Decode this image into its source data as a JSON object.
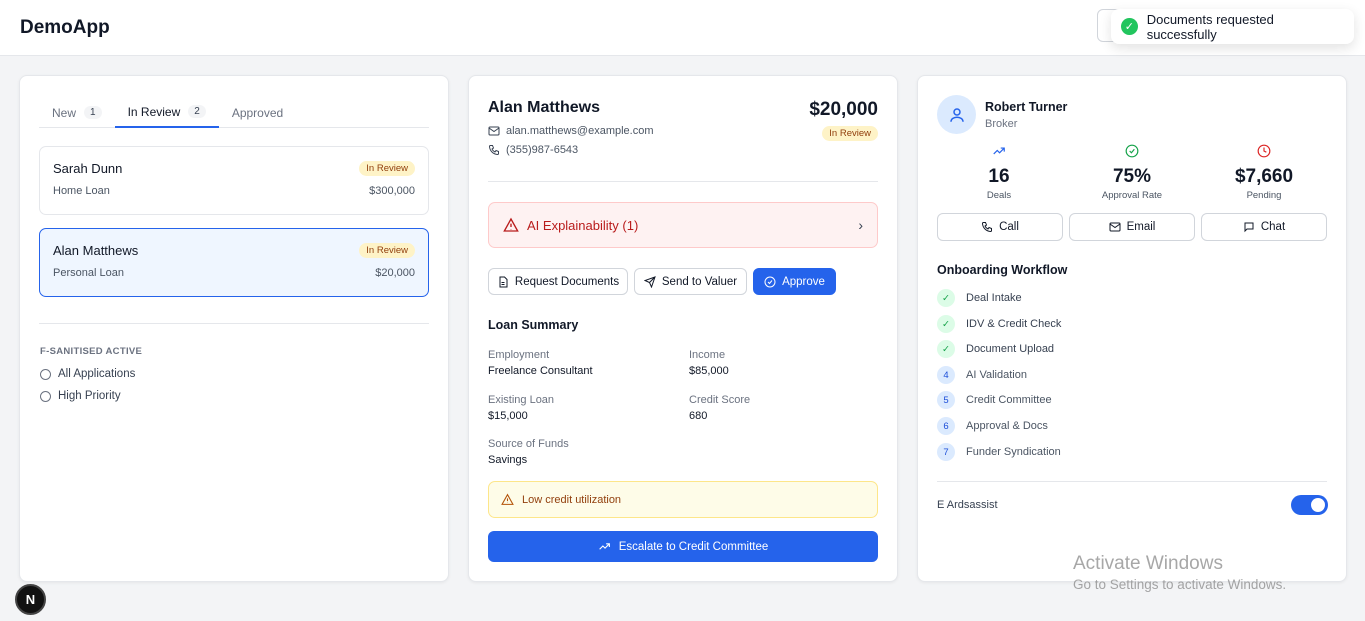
{
  "app": {
    "title": "DemoApp"
  },
  "toast": {
    "message": "Documents requested successfully"
  },
  "left": {
    "tabs": [
      {
        "label": "New",
        "count": "1"
      },
      {
        "label": "In Review",
        "count": "2"
      },
      {
        "label": "Approved",
        "count": ""
      }
    ],
    "cards": [
      {
        "name": "Sarah Dunn",
        "status": "In Review",
        "type": "Home Loan",
        "amount": "$300,000"
      },
      {
        "name": "Alan Matthews",
        "status": "In Review",
        "type": "Personal Loan",
        "amount": "$20,000"
      }
    ],
    "filter_title": "F-SANITISED ACTIVE",
    "filters": [
      "All Applications",
      "High Priority"
    ]
  },
  "detail": {
    "name": "Alan Matthews",
    "amount": "$20,000",
    "status": "In Review",
    "email": "alan.matthews@example.com",
    "phone": "(355)987-6543",
    "ai_label": "AI Explainability (1)",
    "actions": {
      "request_docs": "Request Documents",
      "send_valuer": "Send to Valuer",
      "approve": "Approve"
    },
    "summary_title": "Loan Summary",
    "summary": {
      "employment_label": "Employment",
      "employment": "Freelance Consultant",
      "income_label": "Income",
      "income": "$85,000",
      "existing_label": "Existing Loan",
      "existing": "$15,000",
      "credit_label": "Credit Score",
      "credit": "680",
      "funds_label": "Source of Funds",
      "funds": "Savings"
    },
    "warning": "Low credit utilization",
    "escalate": "Escalate to Credit Committee"
  },
  "broker": {
    "name": "Robert Turner",
    "role": "Broker",
    "stats": [
      {
        "value": "16",
        "label": "Deals",
        "color": "#2563eb"
      },
      {
        "value": "75%",
        "label": "Approval Rate",
        "color": "#16a34a"
      },
      {
        "value": "$7,660",
        "label": "Pending",
        "color": "#dc2626"
      }
    ],
    "contact_buttons": {
      "call": "Call",
      "email": "Email",
      "chat": "Chat"
    },
    "workflow_title": "Onboarding Workflow",
    "workflow": [
      {
        "marker": "✓",
        "label": "Deal Intake",
        "done": true
      },
      {
        "marker": "✓",
        "label": "IDV & Credit Check",
        "done": true
      },
      {
        "marker": "✓",
        "label": "Document Upload",
        "done": true
      },
      {
        "marker": "4",
        "label": "AI Validation",
        "done": false
      },
      {
        "marker": "5",
        "label": "Credit Committee",
        "done": false
      },
      {
        "marker": "6",
        "label": "Approval & Docs",
        "done": false
      },
      {
        "marker": "7",
        "label": "Funder Syndication",
        "done": false
      }
    ],
    "assist_label": "E Ardsassist",
    "assist_on": true
  },
  "os_watermark": {
    "line1": "Activate Windows",
    "line2": "Go to Settings to activate Windows."
  },
  "dev_badge": "N"
}
